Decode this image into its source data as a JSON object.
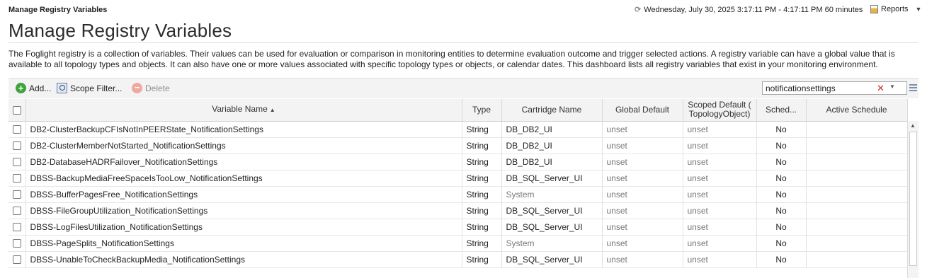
{
  "header": {
    "breadcrumb": "Manage Registry Variables",
    "time_range": "Wednesday, July 30, 2025 3:17:11 PM - 4:17:11 PM 60 minutes",
    "reports_label": "Reports"
  },
  "page": {
    "title": "Manage Registry Variables",
    "description": "The Foglight registry is a collection of variables. Their values can be used for evaluation or comparison in monitoring entities to determine evaluation outcome and trigger selected actions. A registry variable can have a global value that is available to all topology types and objects. It can also have one or more values associated with specific topology types or objects, or calendar dates. This dashboard lists all registry variables that exist in your monitoring environment."
  },
  "toolbar": {
    "add_label": "Add...",
    "scope_filter_label": "Scope Filter...",
    "delete_label": "Delete",
    "search_value": "notificationsettings"
  },
  "table": {
    "headers": {
      "variable_name": "Variable Name",
      "type": "Type",
      "cartridge_name": "Cartridge Name",
      "global_default": "Global Default",
      "scoped_default": "Scoped Default ( TopologyObject)",
      "scheduled": "Sched...",
      "active_schedule": "Active Schedule"
    },
    "rows": [
      {
        "name": "DB2-ClusterBackupCFIsNotInPEERState_NotificationSettings",
        "type": "String",
        "cartridge": "DB_DB2_UI",
        "global": "unset",
        "scoped": "unset",
        "sched": "No",
        "active": ""
      },
      {
        "name": "DB2-ClusterMemberNotStarted_NotificationSettings",
        "type": "String",
        "cartridge": "DB_DB2_UI",
        "global": "unset",
        "scoped": "unset",
        "sched": "No",
        "active": ""
      },
      {
        "name": "DB2-DatabaseHADRFailover_NotificationSettings",
        "type": "String",
        "cartridge": "DB_DB2_UI",
        "global": "unset",
        "scoped": "unset",
        "sched": "No",
        "active": ""
      },
      {
        "name": "DBSS-BackupMediaFreeSpaceIsTooLow_NotificationSettings",
        "type": "String",
        "cartridge": "DB_SQL_Server_UI",
        "global": "unset",
        "scoped": "unset",
        "sched": "No",
        "active": ""
      },
      {
        "name": "DBSS-BufferPagesFree_NotificationSettings",
        "type": "String",
        "cartridge": "System",
        "global": "unset",
        "scoped": "unset",
        "sched": "No",
        "active": ""
      },
      {
        "name": "DBSS-FileGroupUtilization_NotificationSettings",
        "type": "String",
        "cartridge": "DB_SQL_Server_UI",
        "global": "unset",
        "scoped": "unset",
        "sched": "No",
        "active": ""
      },
      {
        "name": "DBSS-LogFilesUtilization_NotificationSettings",
        "type": "String",
        "cartridge": "DB_SQL_Server_UI",
        "global": "unset",
        "scoped": "unset",
        "sched": "No",
        "active": ""
      },
      {
        "name": "DBSS-PageSplits_NotificationSettings",
        "type": "String",
        "cartridge": "System",
        "global": "unset",
        "scoped": "unset",
        "sched": "No",
        "active": ""
      },
      {
        "name": "DBSS-UnableToCheckBackupMedia_NotificationSettings",
        "type": "String",
        "cartridge": "DB_SQL_Server_UI",
        "global": "unset",
        "scoped": "unset",
        "sched": "No",
        "active": ""
      }
    ]
  },
  "colors": {
    "toolbar_bg": "#f3f3f3",
    "add_green": "#3ea33a",
    "clear_red": "#d42a2a",
    "muted_text": "#777777"
  }
}
